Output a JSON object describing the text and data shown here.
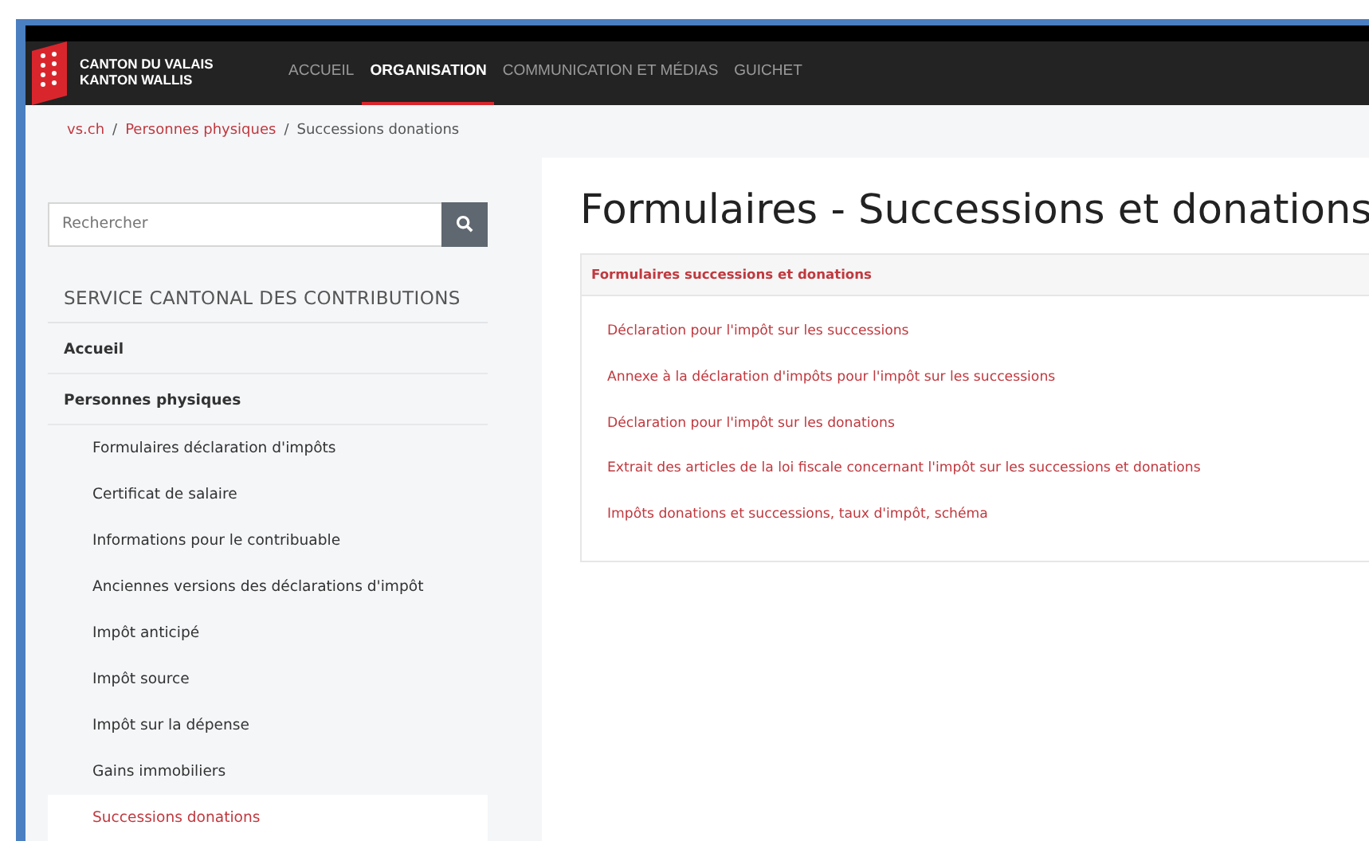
{
  "brand": {
    "line1": "CANTON DU VALAIS",
    "line2": "KANTON WALLIS"
  },
  "nav": [
    {
      "label": "ACCUEIL",
      "selected": false
    },
    {
      "label": "ORGANISATION",
      "selected": true
    },
    {
      "label": "COMMUNICATION ET MÉDIAS",
      "selected": false
    },
    {
      "label": "GUICHET",
      "selected": false
    }
  ],
  "breadcrumb": [
    {
      "label": "vs.ch",
      "link": true
    },
    {
      "label": "/",
      "link": false
    },
    {
      "label": "Personnes physiques",
      "link": true
    },
    {
      "label": "/",
      "link": false
    },
    {
      "label": "Successions donations",
      "link": false
    }
  ],
  "search": {
    "placeholder": "Rechercher"
  },
  "sidebar": {
    "heading": "SERVICE CANTONAL DES CONTRIBUTIONS",
    "items": [
      {
        "label": "Accueil",
        "selected": false
      },
      {
        "label": "Personnes physiques",
        "selected": false,
        "children": [
          {
            "label": "Formulaires déclaration d'impôts",
            "selected": false
          },
          {
            "label": "Certificat de salaire",
            "selected": false
          },
          {
            "label": "Informations pour le contribuable",
            "selected": false
          },
          {
            "label": "Anciennes versions des déclarations d'impôt",
            "selected": false
          },
          {
            "label": "Impôt anticipé",
            "selected": false
          },
          {
            "label": "Impôt source",
            "selected": false
          },
          {
            "label": "Impôt sur la dépense",
            "selected": false
          },
          {
            "label": "Gains immobiliers",
            "selected": false
          },
          {
            "label": "Successions donations",
            "selected": true
          }
        ]
      }
    ]
  },
  "main": {
    "title": "Formulaires - Successions et donations",
    "panel": {
      "heading": "Formulaires successions et donations",
      "links": [
        "Déclaration pour l'impôt sur les successions",
        "Annexe à la déclaration d'impôts pour l'impôt sur les successions",
        "Déclaration pour l'impôt sur les donations",
        "Extrait des articles de la loi fiscale concernant l'impôt sur les successions et donations",
        "Impôts donations et successions, taux d'impôt, schéma"
      ]
    }
  }
}
